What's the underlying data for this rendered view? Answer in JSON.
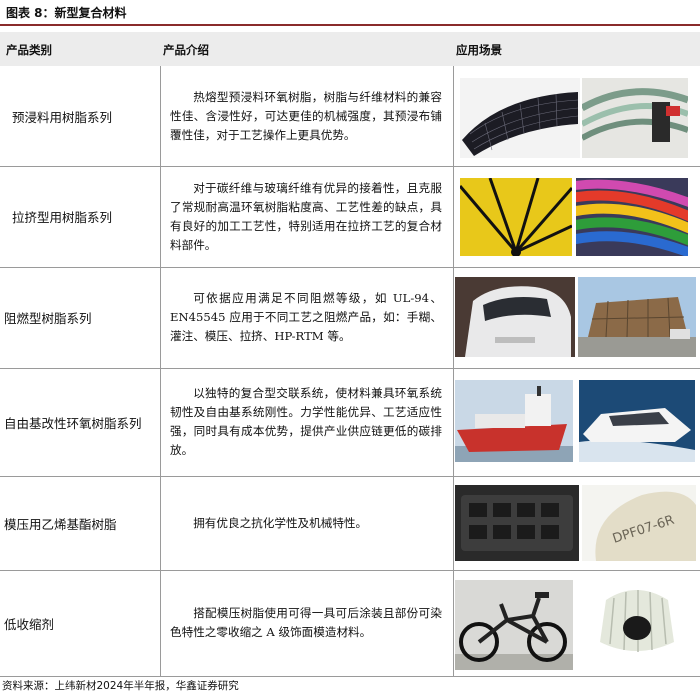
{
  "title": "图表 8：新型复合材料",
  "headers": {
    "category": "产品类别",
    "intro": "产品介绍",
    "scene": "应用场景"
  },
  "rows": [
    {
      "category": "预浸料用树脂系列",
      "intro": "热熔型预浸料环氧树脂，树脂与纤维材料的兼容性佳、含浸性好，可达更佳的机械强度，其预浸布铺覆性佳，对于工艺操作上更具优势。",
      "images": [
        "solar-panel-photo",
        "cables-photo"
      ]
    },
    {
      "category": "拉挤型用树脂系列",
      "intro": "对于碳纤维与玻璃纤维有优异的接着性，且克服了常规耐高温环氧树脂粘度高、工艺性差的缺点，具有良好的加工工艺性，特别适用在拉挤工艺的复合材料部件。",
      "images": [
        "umbrella-photo",
        "colored-rods-photo"
      ]
    },
    {
      "category": "阻燃型树脂系列",
      "intro": "可依据应用满足不同阻燃等级，如 UL-94、EN45545 应用于不同工艺之阻燃产品，如：手糊、灌注、模压、拉挤、HP-RTM 等。",
      "images": [
        "train-nose-photo",
        "building-photo"
      ]
    },
    {
      "category": "自由基改性环氧树脂系列",
      "intro": "以独特的复合型交联系统，使材料兼具环氧系统韧性及自由基系统刚性。力学性能优异、工艺适应性强，同时具有成本优势，提供产业供应链更低的碳排放。",
      "images": [
        "ship-photo",
        "yacht-photo"
      ]
    },
    {
      "category": "模压用乙烯基酯树脂",
      "intro": "拥有优良之抗化学性及机械特性。",
      "images": [
        "molded-part-photo",
        "dpf-part-photo"
      ],
      "stamp_text": "DPF07-6R"
    },
    {
      "category": "低收缩剂",
      "intro": "搭配模压树脂使用可得一具可后涂装且部份可染色特性之零收缩之 A 级饰面模造材料。",
      "images": [
        "bicycle-photo",
        "lamp-photo"
      ]
    }
  ],
  "source": "资料来源：上纬新材2024年半年报，华鑫证券研究"
}
